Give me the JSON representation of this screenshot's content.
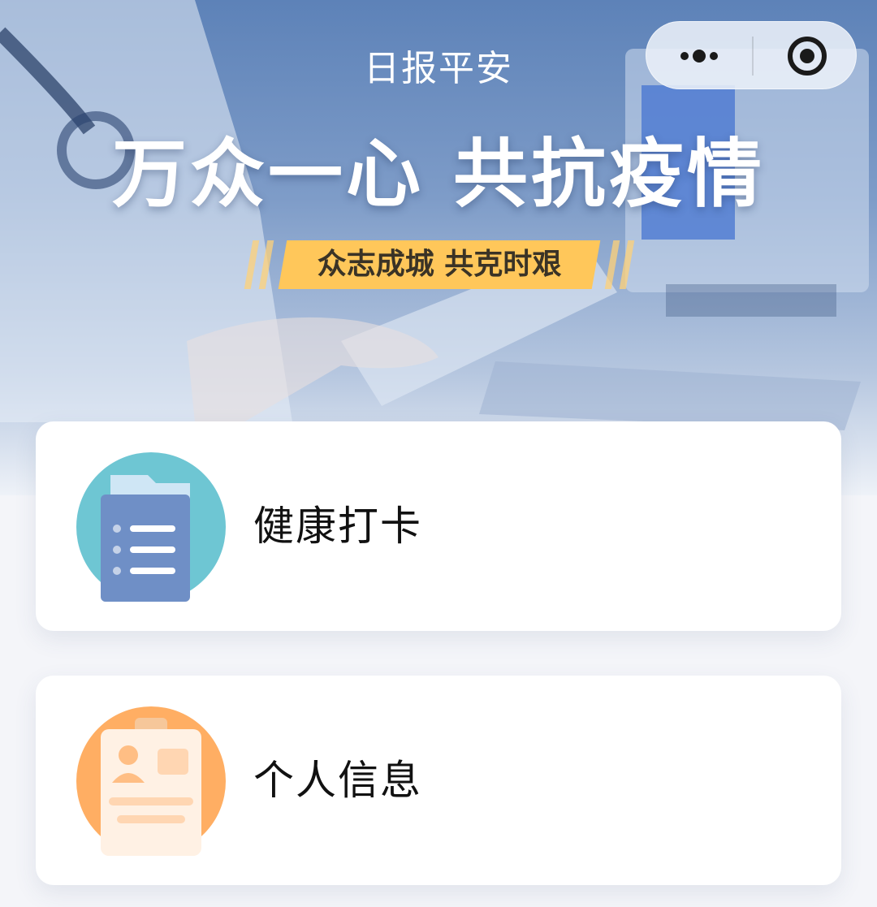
{
  "nav": {
    "title": "日报平安",
    "more_icon": "more-dots-icon",
    "close_icon": "target-close-icon"
  },
  "banner": {
    "headline": "万众一心 共抗疫情",
    "slogan": "众志成城 共克时艰"
  },
  "menu": [
    {
      "label": "健康打卡",
      "icon": "document-folder-icon",
      "color": "#6ec6d3"
    },
    {
      "label": "个人信息",
      "icon": "id-card-icon",
      "color": "#ffae63"
    }
  ],
  "colors": {
    "banner_blue": "#5d82b8",
    "slogan_yellow": "#ffc75a",
    "card_background": "#ffffff",
    "page_background": "#f4f5f9"
  }
}
